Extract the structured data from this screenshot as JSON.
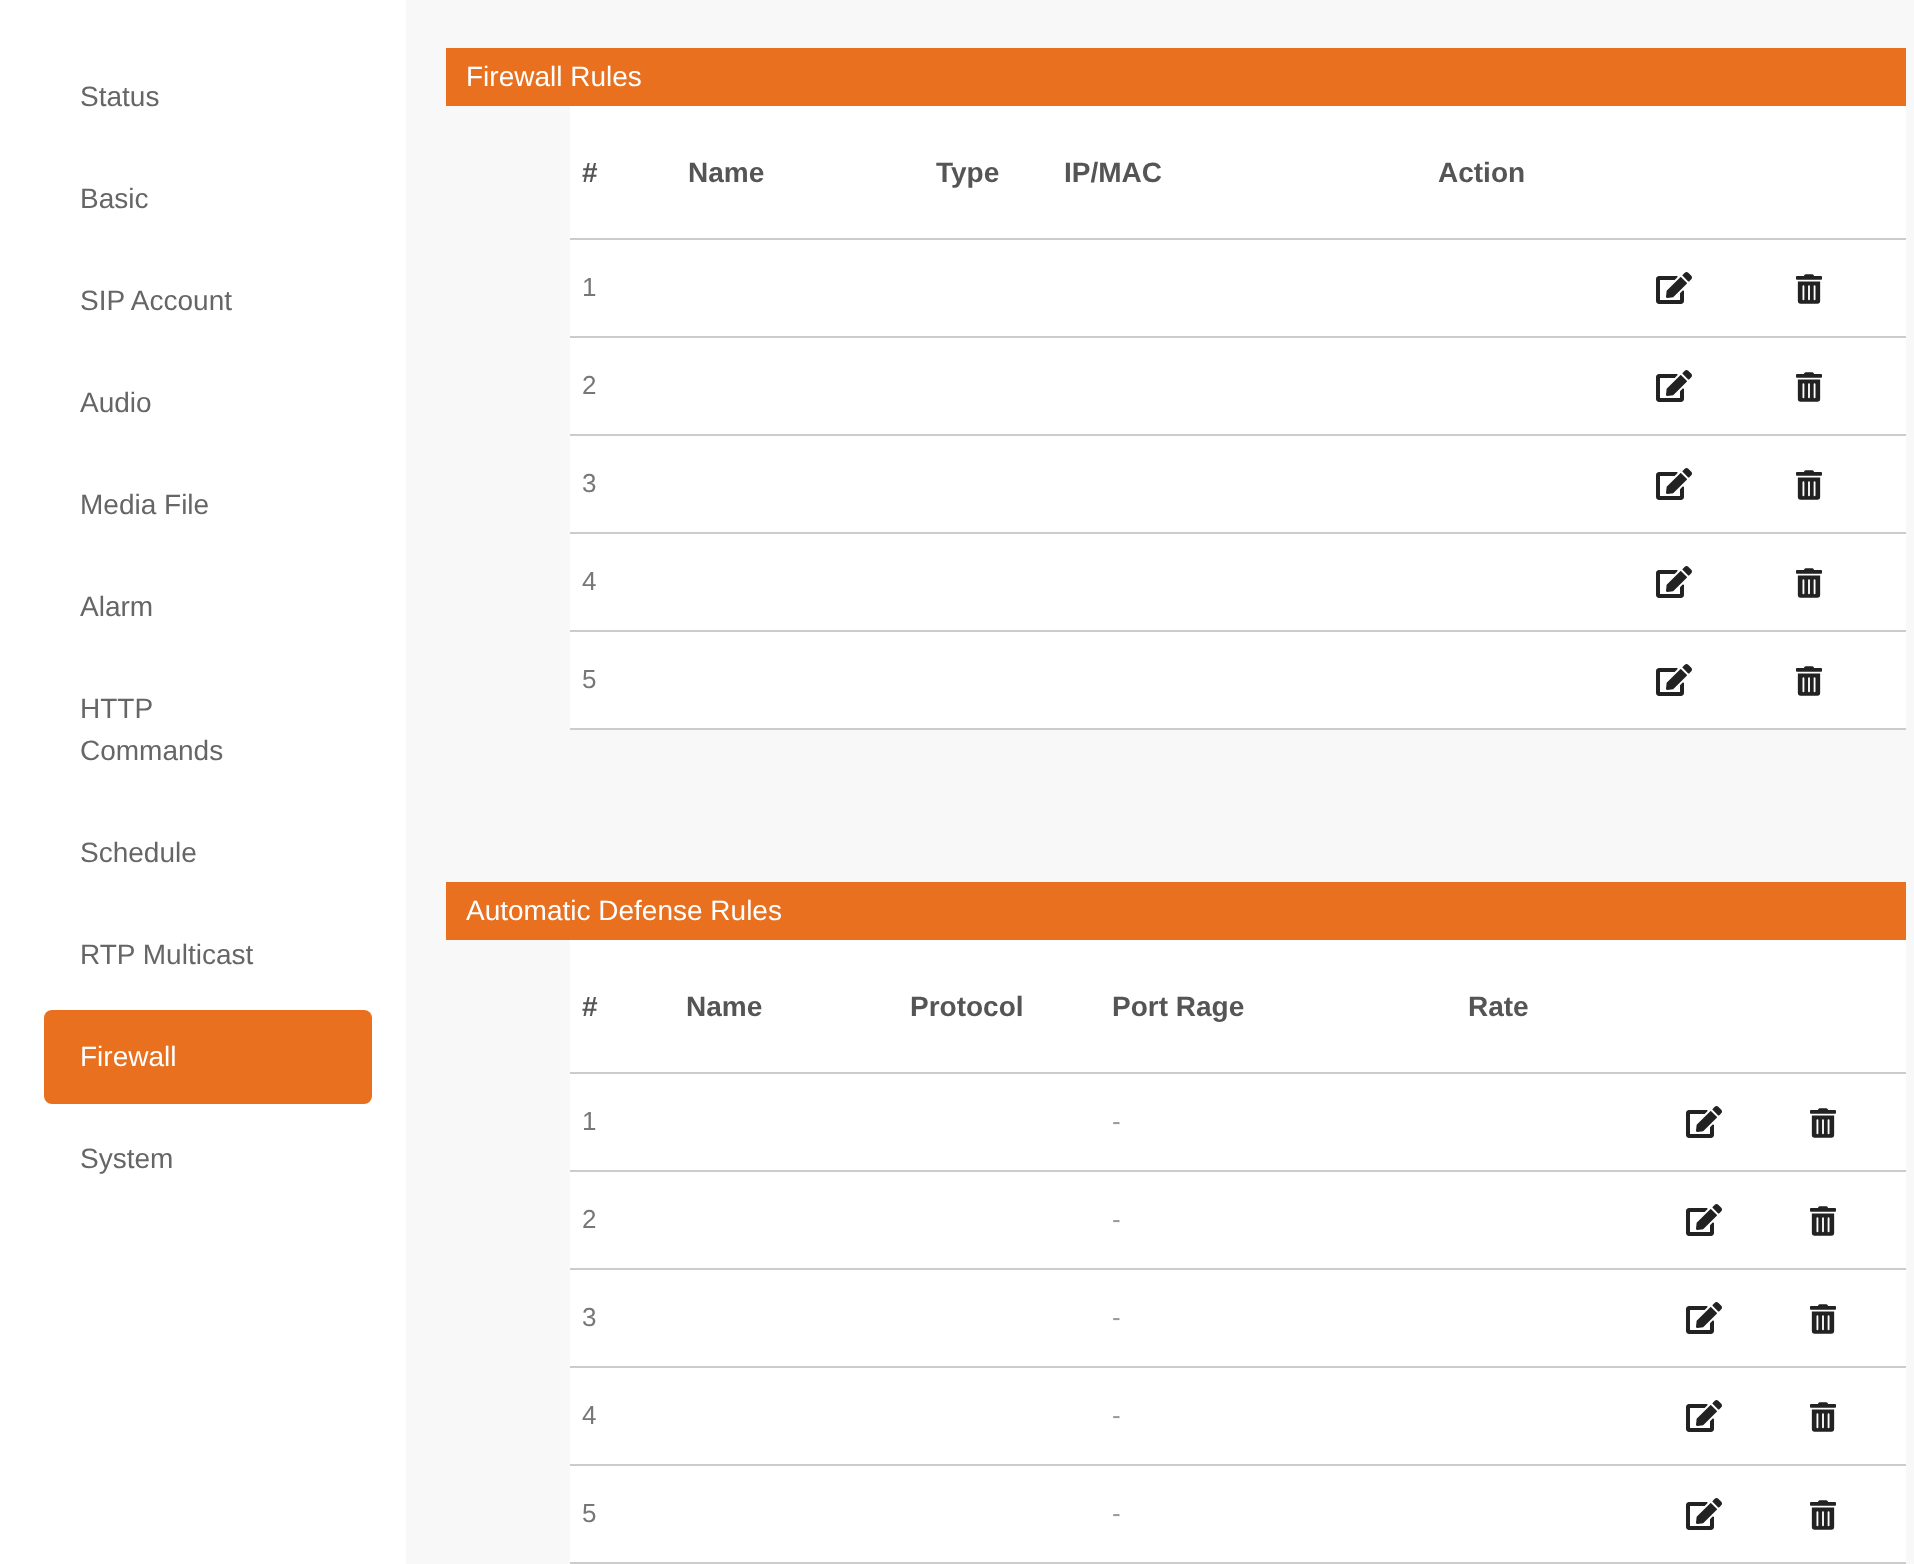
{
  "sidebar": {
    "items": [
      {
        "label": "Status",
        "selected": false
      },
      {
        "label": "Basic",
        "selected": false
      },
      {
        "label": "SIP Account",
        "selected": false
      },
      {
        "label": "Audio",
        "selected": false
      },
      {
        "label": "Media File",
        "selected": false
      },
      {
        "label": "Alarm",
        "selected": false
      },
      {
        "label": "HTTP\nCommands",
        "selected": false
      },
      {
        "label": "Schedule",
        "selected": false
      },
      {
        "label": "RTP Multicast",
        "selected": false
      },
      {
        "label": "Firewall",
        "selected": true
      },
      {
        "label": "System",
        "selected": false
      }
    ]
  },
  "sections": [
    {
      "kind": "firewall",
      "title": "Firewall Rules",
      "columns": [
        "#",
        "Name",
        "Type",
        "IP/MAC",
        "Action"
      ],
      "rows": [
        {
          "number": "1"
        },
        {
          "number": "2"
        },
        {
          "number": "3"
        },
        {
          "number": "4"
        },
        {
          "number": "5"
        }
      ]
    },
    {
      "kind": "defense",
      "title": "Automatic Defense Rules",
      "columns": [
        "#",
        "Name",
        "Protocol",
        "Port Rage",
        "Rate"
      ],
      "rows": [
        {
          "number": "1",
          "port_rage": "-"
        },
        {
          "number": "2",
          "port_rage": "-"
        },
        {
          "number": "3",
          "port_rage": "-"
        },
        {
          "number": "4",
          "port_rage": "-"
        },
        {
          "number": "5",
          "port_rage": "-"
        }
      ]
    }
  ]
}
